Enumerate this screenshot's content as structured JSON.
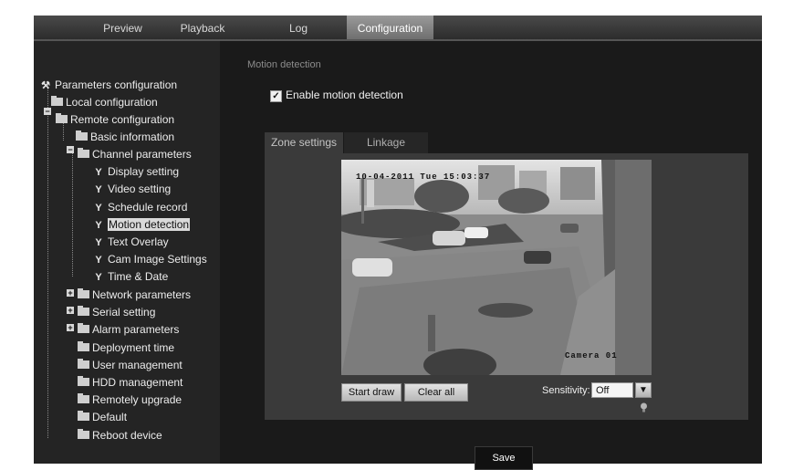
{
  "tabs": [
    "Preview",
    "Playback",
    "Log",
    "Configuration"
  ],
  "active_tab": "Configuration",
  "sidebar": {
    "root_label": "Parameters configuration",
    "items": [
      "Local configuration",
      "Remote configuration",
      "Basic information",
      "Channel parameters",
      "Display setting",
      "Video setting",
      "Schedule record",
      "Motion detection",
      "Text Overlay",
      "Cam Image Settings",
      "Time & Date",
      "Network parameters",
      "Serial setting",
      "Alarm parameters",
      "Deployment time",
      "User management",
      "HDD management",
      "Remotely upgrade",
      "Default",
      "Reboot device"
    ],
    "selected": "Motion detection"
  },
  "main": {
    "section_title": "Motion detection",
    "enable_label": "Enable motion detection",
    "enable_checked": true,
    "subtabs": [
      "Zone settings",
      "Linkage"
    ],
    "active_subtab": "Zone settings",
    "video": {
      "timestamp": "10-04-2011 Tue 15:03:37",
      "camera_label": "Camera 01"
    },
    "start_draw_label": "Start draw",
    "clear_all_label": "Clear all",
    "sensitivity_label": "Sensitivity:",
    "sensitivity_value": "Off",
    "save_label": "Save"
  },
  "icons": {
    "tree_root": "wrench-icon",
    "folder": "folder-icon",
    "leaf": "fork-icon",
    "dropdown": "chevron-down-icon",
    "hint": "lightbulb-icon"
  }
}
